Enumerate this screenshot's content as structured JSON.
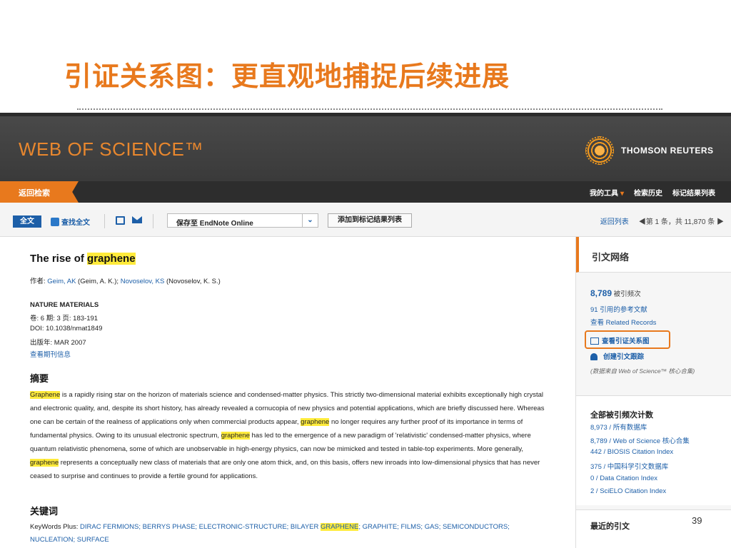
{
  "slide": {
    "title": "引证关系图：更直观地捕捉后续进展",
    "page_number": "39"
  },
  "header": {
    "wos_logo": "WEB OF SCIENCE™",
    "tr_logo": "THOMSON REUTERS"
  },
  "nav": {
    "back": "返回检索",
    "links": [
      "我的工具",
      "检索历史",
      "标记结果列表"
    ]
  },
  "toolbar": {
    "full_text_btn": "全文",
    "find_full_text": "查找全文",
    "save_select": "保存至 EndNote Online",
    "add_to_marked": "添加到标记结果列表",
    "back_to_list": "返回列表",
    "pager": "◀第 1 条，共 11,870 条 ▶"
  },
  "record": {
    "title_pre": "The rise of ",
    "title_hl": "graphene",
    "authors_label": "作者: ",
    "author1": "Geim, AK",
    "author1_full": " (Geim, A. K.); ",
    "author2": "Novoselov, KS",
    "author2_full": " (Novoselov, K. S.)",
    "journal": "NATURE MATERIALS",
    "volume_line": "卷: 6  期: 3  页: 183-191",
    "doi_line": "DOI: 10.1038/nmat1849",
    "pub_date": "出版年: MAR 2007",
    "journal_info_link": "查看期刊信息",
    "abstract_heading": "摘要",
    "abstract_parts": [
      {
        "t": "Graphene",
        "hl": true
      },
      {
        "t": " is a rapidly rising star on the horizon of materials science and condensed-matter physics. This strictly two-dimensional material exhibits exceptionally high crystal and electronic quality, and, despite its short history, has already revealed a cornucopia of new physics and potential applications, which are briefly discussed here. Whereas one can be certain of the realness of applications only when commercial products appear, ",
        "hl": false
      },
      {
        "t": "graphene",
        "hl": true
      },
      {
        "t": " no longer requires any further proof of its importance in terms of fundamental physics. Owing to its unusual electronic spectrum, ",
        "hl": false
      },
      {
        "t": "graphene",
        "hl": true
      },
      {
        "t": " has led to the emergence of a new paradigm of 'relativistic' condensed-matter physics, where quantum relativistic phenomena, some of which are unobservable in high-energy physics, can now be mimicked and tested in table-top experiments. More generally, ",
        "hl": false
      },
      {
        "t": "graphene",
        "hl": true
      },
      {
        "t": " represents a conceptually new class of materials that are only one atom thick, and, on this basis, offers new inroads into low-dimensional physics that has never ceased to surprise and continues to provide a fertile ground for applications.",
        "hl": false
      }
    ],
    "keywords_heading": "关键词",
    "keywords_label": "KeyWords Plus: ",
    "keywords_a": "DIRAC FERMIONS; BERRYS PHASE; ELECTRONIC-STRUCTURE; BILAYER ",
    "keywords_hl": "GRAPHENE",
    "keywords_b": "; GRAPHITE; FILMS; GAS; SEMICONDUCTORS; NUCLEATION; SURFACE"
  },
  "sidebar": {
    "heading": "引文网络",
    "times_cited_num": "8,789",
    "times_cited_label": "被引频次",
    "cited_refs": "91 引用的参考文献",
    "related_records": "查看 Related Records",
    "citation_map": "查看引证关系图",
    "create_alert": "创建引文跟踪",
    "note": "(数据来自 Web of Science™ 核心合集)",
    "all_counts_heading": "全部被引频次计数",
    "counts": [
      "8,973 / 所有数据库",
      "8,789 / Web of Science 核心合集",
      "442 / BIOSIS Citation Index",
      "375 / 中国科学引文数据库",
      "0 / Data Citation Index",
      "2 / SciELO Citation Index"
    ],
    "recent_heading": "最近的引文"
  }
}
